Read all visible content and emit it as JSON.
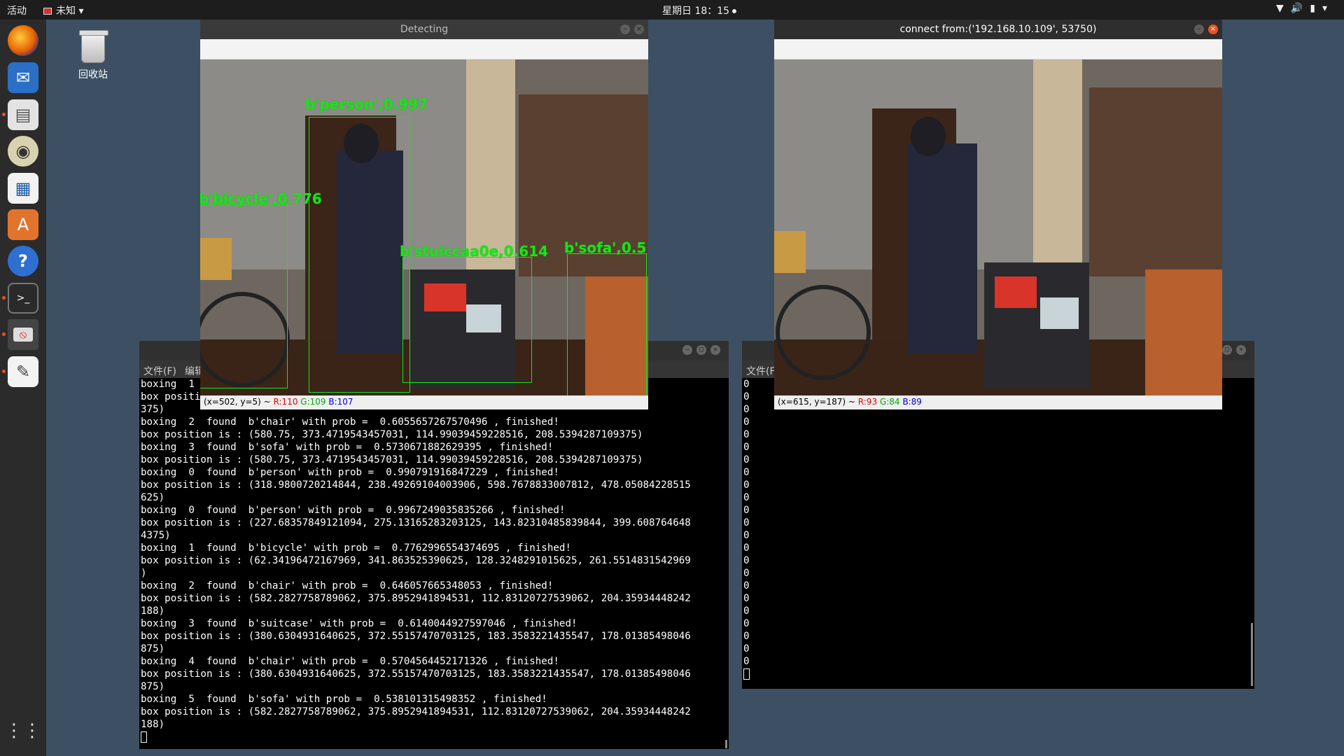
{
  "topbar": {
    "activities": "活动",
    "app_menu": "未知 ▾",
    "clock": "星期日 18：15"
  },
  "desktop": {
    "trash_label": "回收站"
  },
  "dock": {
    "icons": [
      "firefox-icon",
      "thunderbird-icon",
      "files-icon",
      "rhythmbox-icon",
      "libreoffice-writer-icon",
      "software-center-icon",
      "help-icon",
      "terminal-icon",
      "stop-app-icon",
      "text-editor-icon",
      "show-apps-icon"
    ]
  },
  "detect_window": {
    "title": "Detecting",
    "status_coords": "(x=502, y=5) ~ ",
    "status_r": "R:110",
    "status_g": "G:109",
    "status_b": "B:107",
    "labels": {
      "person": "b'person',0.997",
      "bicycle": "b'bicycle',0.776",
      "suitcase": "b'stuiccaa0e,0.614",
      "chair": "b'sofa',0.5"
    }
  },
  "stream_window": {
    "title": "connect from:('192.168.10.109', 53750)",
    "status_coords": "(x=615, y=187) ~ ",
    "status_r": "R:93",
    "status_g": "G:84",
    "status_b": "B:89"
  },
  "left_terminal": {
    "menu": [
      "文件(F)",
      "编辑"
    ],
    "lines": [
      "boxing  1",
      "box positi                                                               86273193359",
      "375)",
      "boxing  2  found  b'chair' with prob =  0.6055657267570496 , finished!",
      "box position is : (580.75, 373.4719543457031, 114.99039459228516, 208.5394287109375)",
      "boxing  3  found  b'sofa' with prob =  0.5730671882629395 , finished!",
      "box position is : (580.75, 373.4719543457031, 114.99039459228516, 208.5394287109375)",
      "boxing  0  found  b'person' with prob =  0.990791916847229 , finished!",
      "box position is : (318.9800720214844, 238.49269104003906, 598.7678833007812, 478.05084228515",
      "625)",
      "boxing  0  found  b'person' with prob =  0.9967249035835266 , finished!",
      "box position is : (227.68357849121094, 275.13165283203125, 143.82310485839844, 399.608764648",
      "4375)",
      "boxing  1  found  b'bicycle' with prob =  0.7762996554374695 , finished!",
      "box position is : (62.34196472167969, 341.863525390625, 128.3248291015625, 261.5514831542969",
      ")",
      "boxing  2  found  b'chair' with prob =  0.646057665348053 , finished!",
      "box position is : (582.2827758789062, 375.8952941894531, 112.83120727539062, 204.35934448242",
      "188)",
      "boxing  3  found  b'suitcase' with prob =  0.6140044927597046 , finished!",
      "box position is : (380.6304931640625, 372.55157470703125, 183.3583221435547, 178.01385498046",
      "875)",
      "boxing  4  found  b'chair' with prob =  0.5704564452171326 , finished!",
      "box position is : (380.6304931640625, 372.55157470703125, 183.3583221435547, 178.01385498046",
      "875)",
      "boxing  5  found  b'sofa' with prob =  0.538101315498352 , finished!",
      "box position is : (582.2827758789062, 375.8952941894531, 112.83120727539062, 204.35934448242",
      "188)"
    ]
  },
  "right_terminal": {
    "menu": [
      "文件(F"
    ],
    "zeros": [
      "0",
      "0",
      "0",
      "0",
      "0",
      "0",
      "0",
      "0",
      "0",
      "0",
      "0",
      "0",
      "0",
      "0",
      "0",
      "0",
      "0",
      "0",
      "0",
      "0",
      "0",
      "0",
      "0"
    ]
  }
}
